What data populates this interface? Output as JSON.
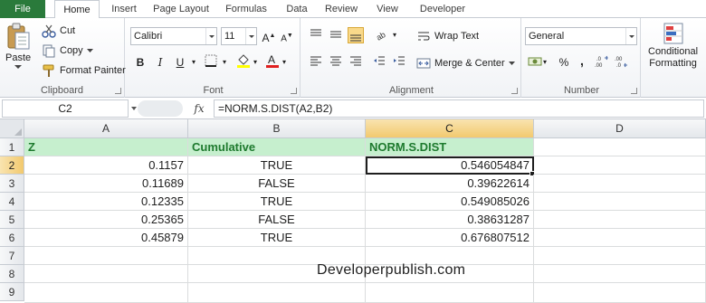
{
  "tabs": [
    "File",
    "Home",
    "Insert",
    "Page Layout",
    "Formulas",
    "Data",
    "Review",
    "View",
    "Developer"
  ],
  "active_tab": "Home",
  "ribbon": {
    "clipboard": {
      "paste": "Paste",
      "cut": "Cut",
      "copy": "Copy",
      "format_painter": "Format Painter",
      "label": "Clipboard"
    },
    "font": {
      "family": "Calibri",
      "size": "11",
      "label": "Font",
      "bold": "B",
      "italic": "I",
      "underline": "U",
      "font_color_glyph": "A"
    },
    "alignment": {
      "wrap_text": "Wrap Text",
      "merge_center": "Merge & Center",
      "label": "Alignment"
    },
    "number": {
      "format": "General",
      "percent": "%",
      "comma": ",",
      "label": "Number"
    },
    "styles": {
      "conditional_line1": "Conditional",
      "conditional_line2": "Formatting"
    },
    "colors": {
      "file_tab": "#2a7a3b",
      "header_fill": "#c6efce",
      "header_text": "#1e7a2e",
      "fill_color": "#ffff00",
      "font_color": "#e02020"
    }
  },
  "formula_bar": {
    "name_box": "C2",
    "fx": "fx",
    "formula": "=NORM.S.DIST(A2,B2)"
  },
  "sheet": {
    "columns": [
      "A",
      "B",
      "C",
      "D"
    ],
    "selected_column": "C",
    "rows": [
      "1",
      "2",
      "3",
      "4",
      "5",
      "6",
      "7",
      "8",
      "9"
    ],
    "selected_row": "2",
    "headers": [
      "Z",
      "Cumulative",
      "NORM.S.DIST"
    ],
    "data": [
      [
        "0.1157",
        "TRUE",
        "0.546054847"
      ],
      [
        "0.11689",
        "FALSE",
        "0.39622614"
      ],
      [
        "0.12335",
        "TRUE",
        "0.549085026"
      ],
      [
        "0.25365",
        "FALSE",
        "0.38631287"
      ],
      [
        "0.45879",
        "TRUE",
        "0.676807512"
      ]
    ],
    "watermark": "Developerpublish.com"
  }
}
